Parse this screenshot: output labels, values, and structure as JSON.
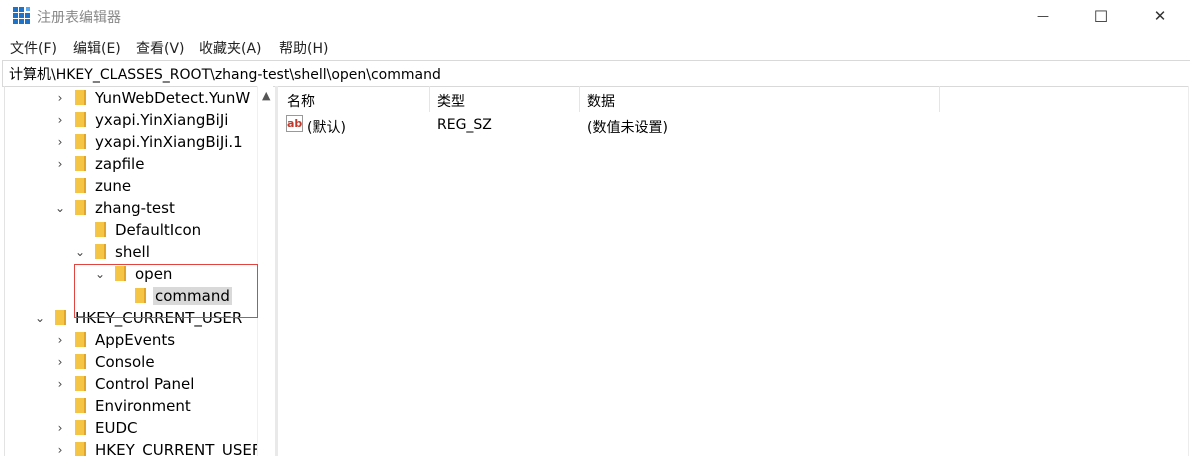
{
  "window": {
    "title": "注册表编辑器",
    "controls": {
      "minimize": "—",
      "maximize": "☐",
      "close": "✕"
    }
  },
  "menu": [
    "文件(F)",
    "编辑(E)",
    "查看(V)",
    "收藏夹(A)",
    "帮助(H)"
  ],
  "address": "计算机\\HKEY_CLASSES_ROOT\\zhang-test\\shell\\open\\command",
  "tree": [
    {
      "label": "YunWebDetect.YunW",
      "expander": "collapsed"
    },
    {
      "label": "yxapi.YinXiangBiJi",
      "expander": "collapsed"
    },
    {
      "label": "yxapi.YinXiangBiJi.1",
      "expander": "collapsed"
    },
    {
      "label": "zapfile",
      "expander": "collapsed"
    },
    {
      "label": "zune",
      "expander": "none"
    },
    {
      "label": "zhang-test",
      "expander": "expanded"
    },
    {
      "label": "DefaultIcon",
      "expander": "none"
    },
    {
      "label": "shell",
      "expander": "expanded"
    },
    {
      "label": "open",
      "expander": "expanded"
    },
    {
      "label": "command",
      "expander": "none",
      "selected": true
    },
    {
      "label": "HKEY_CURRENT_USER",
      "expander": "expanded"
    },
    {
      "label": "AppEvents",
      "expander": "collapsed"
    },
    {
      "label": "Console",
      "expander": "collapsed"
    },
    {
      "label": "Control Panel",
      "expander": "collapsed"
    },
    {
      "label": "Environment",
      "expander": "none"
    },
    {
      "label": "EUDC",
      "expander": "collapsed"
    },
    {
      "label": "HKEY_CURRENT_USEF",
      "expander": "collapsed"
    }
  ],
  "values_table": {
    "columns": [
      "名称",
      "类型",
      "数据"
    ],
    "rows": [
      {
        "icon": "string-value-icon",
        "icon_text": "ab",
        "name": "(默认)",
        "type": "REG_SZ",
        "data": "(数值未设置)"
      }
    ]
  },
  "colors": {
    "folder": "#f5c546",
    "highlight_box": "#e0463f",
    "selected": "#d9d9d9"
  }
}
